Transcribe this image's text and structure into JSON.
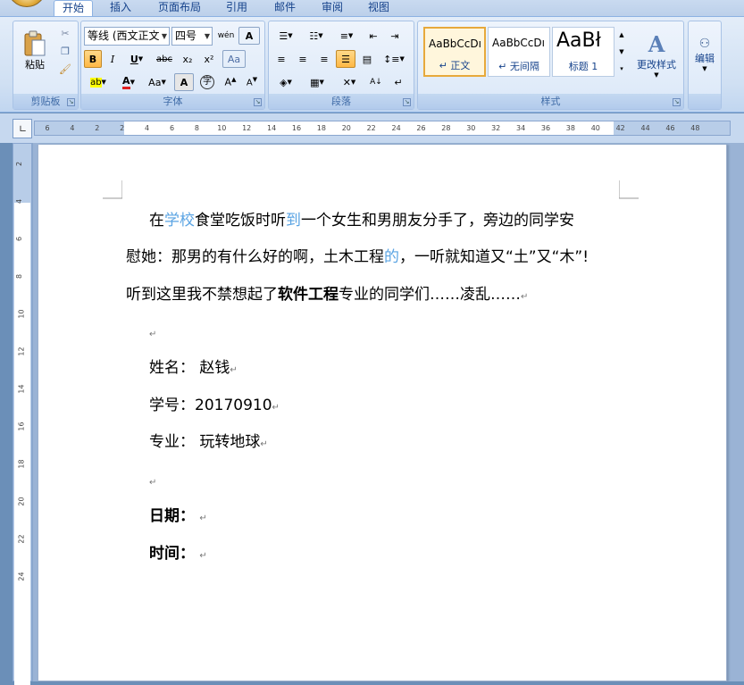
{
  "tabs": [
    "开始",
    "插入",
    "页面布局",
    "引用",
    "邮件",
    "审阅",
    "视图"
  ],
  "clipboard": {
    "paste_label": "粘贴",
    "group_label": "剪贴板"
  },
  "font": {
    "font_name": "等线 (西文正文",
    "font_size": "四号",
    "group_label": "字体"
  },
  "paragraph": {
    "group_label": "段落"
  },
  "styles": {
    "items": [
      {
        "preview": "AaBbCcDı",
        "name": "↵ 正文"
      },
      {
        "preview": "AaBbCcDı",
        "name": "↵ 无间隔"
      },
      {
        "preview": "AaBł",
        "name": "标题 1"
      }
    ],
    "change_label": "更改样式",
    "group_label": "样式"
  },
  "editing": {
    "label": "编辑"
  },
  "ruler": {
    "h_ticks": [
      "6",
      "4",
      "2",
      "2",
      "4",
      "6",
      "8",
      "10",
      "12",
      "14",
      "16",
      "18",
      "20",
      "22",
      "24",
      "26",
      "28",
      "30",
      "32",
      "34",
      "36",
      "38",
      "40",
      "42",
      "44",
      "46",
      "48"
    ],
    "v_ticks": [
      "2",
      "4",
      "6",
      "8",
      "10",
      "12",
      "14",
      "16",
      "18",
      "20",
      "22",
      "24"
    ]
  },
  "document": {
    "p1_a": "在",
    "p1_b": "学校",
    "p1_c": "食堂吃饭时听",
    "p1_d": "到",
    "p1_e": "一个女生和男朋友分手了，旁边的同学安",
    "p2_a": "慰她：那男的有什么好的啊，土木工程",
    "p2_b": "的",
    "p2_c": "，一听就知道又“土”又“木”!",
    "p3_a": "听到这里我不禁想起了",
    "p3_b": "软件工程",
    "p3_c": "专业的同学们……凌乱……",
    "name_line": "姓名： 赵钱",
    "id_line": "学号：20170910",
    "major_line": "专业： 玩转地球",
    "date_line": "日期：",
    "time_line": "时间：",
    "para_mark": "↵"
  },
  "colors": {
    "link_blue": "#5ba4e3",
    "ribbon_accent": "#15428b"
  }
}
